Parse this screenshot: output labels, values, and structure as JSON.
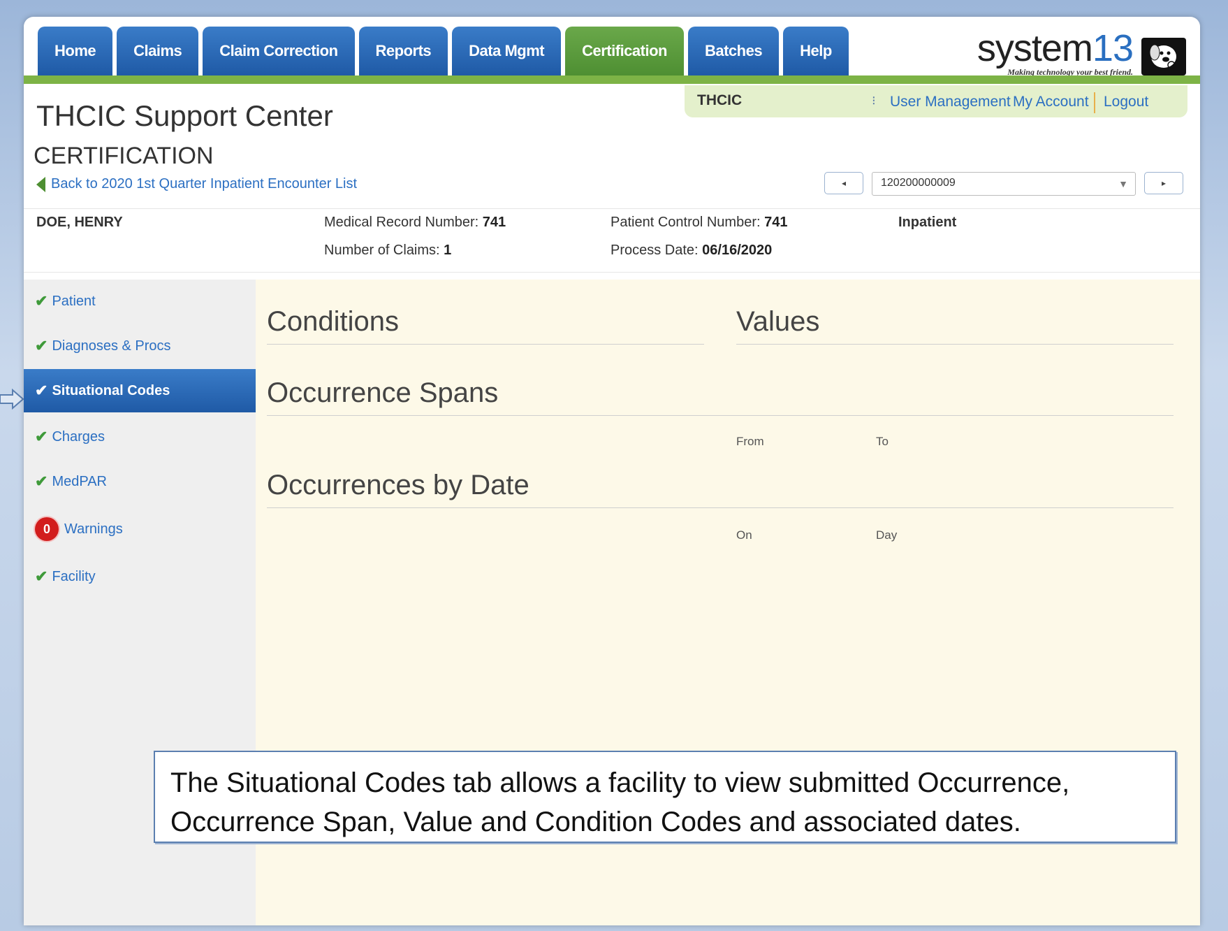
{
  "nav": {
    "tabs": [
      {
        "label": "Home"
      },
      {
        "label": "Claims"
      },
      {
        "label": "Claim Correction"
      },
      {
        "label": "Reports"
      },
      {
        "label": "Data Mgmt"
      },
      {
        "label": "Certification",
        "active": true
      },
      {
        "label": "Batches"
      },
      {
        "label": "Help"
      }
    ]
  },
  "logo": {
    "brand": "system",
    "brand_num": "13",
    "tagline": "Making technology your best friend.",
    "icon": "dog-icon"
  },
  "user_bar": {
    "org": "THCIC",
    "separator": "⁝",
    "user_management": "User Management",
    "my_account": "My Account",
    "logout": "Logout"
  },
  "header": {
    "title": "THCIC Support Center",
    "subtitle": "CERTIFICATION",
    "back_link": "Back to 2020 1st Quarter Inpatient Encounter List",
    "encounter_select": "120200000009",
    "prev_glyph": "◂",
    "next_glyph": "▸",
    "select_caret": "▼"
  },
  "patient": {
    "name": "DOE, HENRY",
    "mrn_label": "Medical Record Number: ",
    "mrn": "741",
    "claims_label": "Number of Claims: ",
    "claims": "1",
    "pcn_label": "Patient Control Number: ",
    "pcn": "741",
    "process_label": "Process Date: ",
    "process_date": "06/16/2020",
    "type": "Inpatient"
  },
  "sidebar": {
    "check": "✔",
    "items": [
      {
        "label": "Patient"
      },
      {
        "label": "Diagnoses & Procs"
      },
      {
        "label": "Situational Codes",
        "active": true
      },
      {
        "label": "Charges"
      },
      {
        "label": "MedPAR"
      },
      {
        "label": "Warnings",
        "badge": "0"
      },
      {
        "label": "Facility"
      }
    ]
  },
  "main": {
    "conditions": "Conditions",
    "values": "Values",
    "occurrence_spans": "Occurrence Spans",
    "from": "From",
    "to": "To",
    "occurrences_by_date": "Occurrences by Date",
    "on": "On",
    "day": "Day"
  },
  "callout": {
    "text": "The Situational Codes tab allows a facility to view submitted Occurrence, Occurrence Span, Value and Condition Codes and associated dates."
  },
  "colors": {
    "nav_blue": "#1f5aa6",
    "active_green": "#4e8f32",
    "link_blue": "#2b6fc2",
    "content_bg": "#fdf9e8",
    "badge_red": "#d21d1d"
  }
}
